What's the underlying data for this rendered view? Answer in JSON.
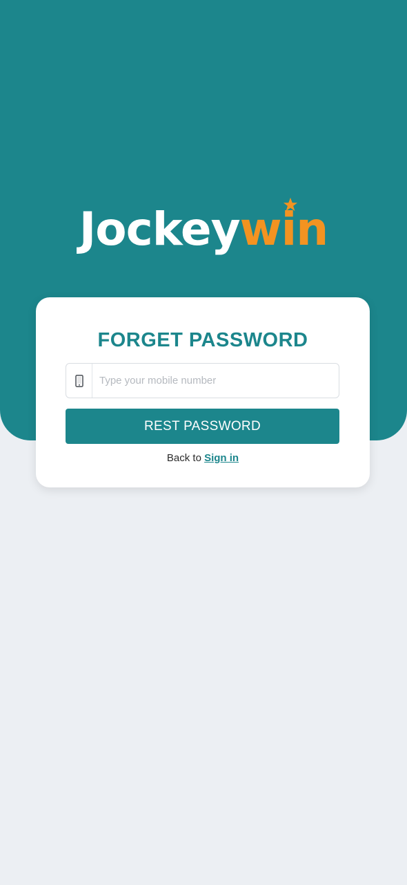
{
  "brand": {
    "name_part1": "Jockey",
    "name_part2": "win",
    "primary_color": "#1c868c",
    "accent_color": "#f39321"
  },
  "form": {
    "title": "FORGET PASSWORD",
    "mobile_input": {
      "placeholder": "Type your mobile number",
      "value": "",
      "icon": "mobile-phone-icon"
    },
    "submit_label": "REST PASSWORD",
    "back_text": "Back to",
    "sign_in_label": "Sign in"
  }
}
